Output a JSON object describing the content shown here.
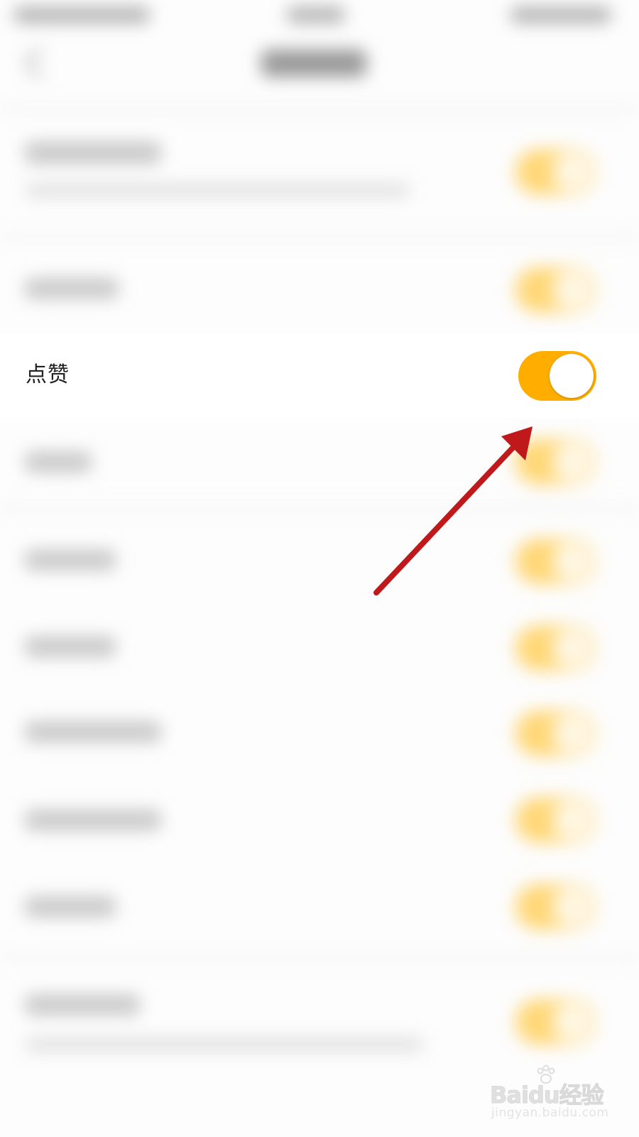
{
  "setting_row": {
    "label": "点赞",
    "toggle_on": true
  },
  "colors": {
    "toggle_on": "#ffae00",
    "arrow": "#c0191b",
    "blurred_toggle": "#ffd369"
  },
  "watermark": {
    "brand": "Baidu经验",
    "url": "jingyan.baidu.com"
  }
}
